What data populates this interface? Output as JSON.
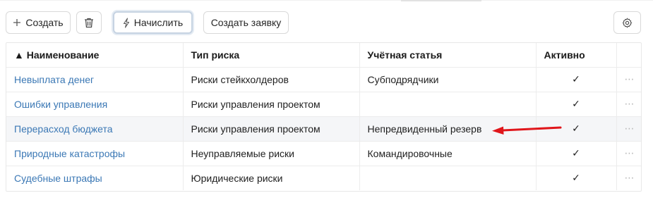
{
  "toolbar": {
    "create_label": "Создать",
    "accrue_label": "Начислить",
    "request_label": "Создать заявку"
  },
  "table": {
    "sort_indicator": "▲",
    "columns": [
      "Наименование",
      "Тип риска",
      "Учётная статья",
      "Активно"
    ],
    "rows": [
      {
        "name": "Невыплата денег",
        "risk_type": "Риски стейкхолдеров",
        "account": "Субподрядчики",
        "active": "✓",
        "more": "⋯"
      },
      {
        "name": "Ошибки управления",
        "risk_type": "Риски управления проектом",
        "account": "",
        "active": "✓",
        "more": "⋯"
      },
      {
        "name": "Перерасход бюджета",
        "risk_type": "Риски управления проектом",
        "account": "Непредвиденный резерв",
        "active": "✓",
        "more": "⋯"
      },
      {
        "name": "Природные катастрофы",
        "risk_type": "Неуправляемые риски",
        "account": "Командировочные",
        "active": "✓",
        "more": "⋯"
      },
      {
        "name": "Судебные штрафы",
        "risk_type": "Юридические риски",
        "account": "",
        "active": "✓",
        "more": "⋯"
      }
    ]
  },
  "colors": {
    "link": "#3b78b5",
    "annotation_arrow": "#e0161b",
    "highlight_row": "#f5f6f8"
  },
  "icons": [
    "plus-icon",
    "trash-icon",
    "lightning-icon",
    "gear-icon",
    "check-icon",
    "more-icon",
    "annotation-arrow"
  ]
}
